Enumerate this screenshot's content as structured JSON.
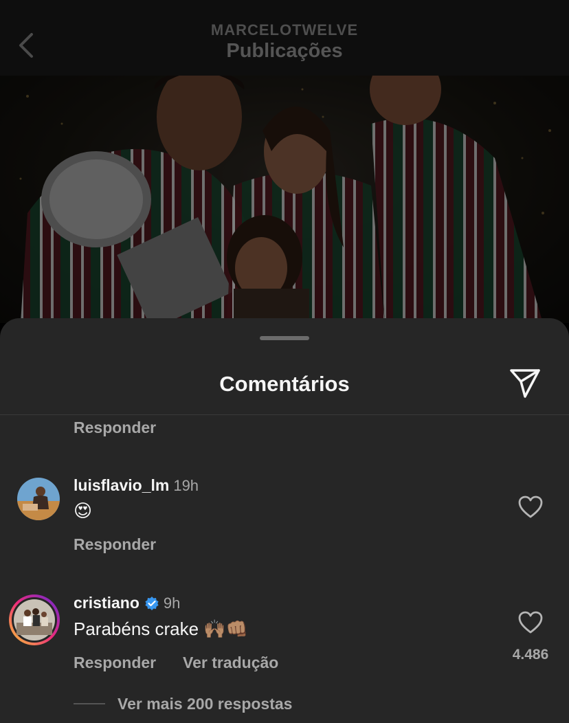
{
  "header": {
    "username": "MARCELOTWELVE",
    "title": "Publicações",
    "back_icon": "chevron-left-icon"
  },
  "post_photo": {
    "description_icon": "photo-image"
  },
  "sheet": {
    "title": "Comentários",
    "share_icon": "paper-plane-icon",
    "previous_reply_label": "Responder"
  },
  "comments": [
    {
      "username": "luisflavio_lm",
      "time": "19h",
      "text": "😍",
      "reply_label": "Responder",
      "liked": false
    },
    {
      "username": "cristiano",
      "verified": true,
      "time": "9h",
      "text": "Parabéns crake 🙌🏽👊🏽",
      "reply_label": "Responder",
      "translate_label": "Ver tradução",
      "likes": "4.486",
      "more_replies": "Ver mais 200 respostas"
    }
  ],
  "colors": {
    "background": "#262626",
    "text": "#f5f5f5",
    "muted": "#a8a8a8",
    "verified": "#3897f0",
    "story_ring_start": "#f9ce34",
    "story_ring_end": "#c2187b"
  }
}
